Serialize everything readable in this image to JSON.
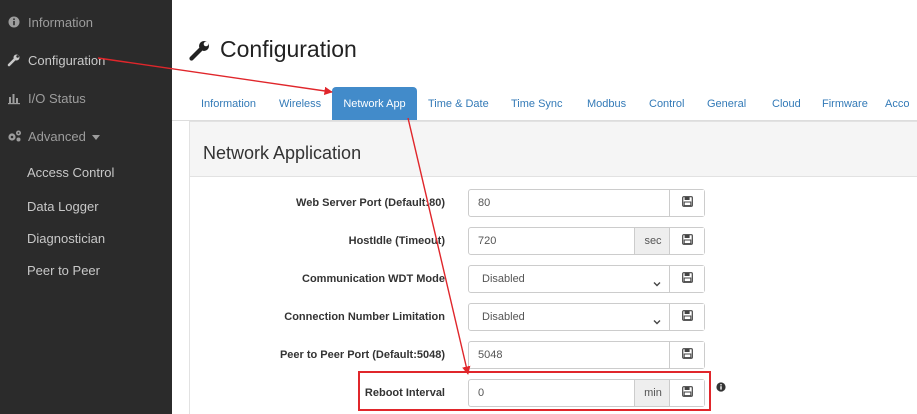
{
  "sidebar": {
    "items": [
      {
        "label": "Information"
      },
      {
        "label": "Configuration"
      },
      {
        "label": "I/O Status"
      },
      {
        "label": "Advanced"
      }
    ],
    "advanced_sub": [
      {
        "label": "Access Control"
      },
      {
        "label": "Data Logger"
      },
      {
        "label": "Diagnostician"
      },
      {
        "label": "Peer to Peer"
      }
    ]
  },
  "page": {
    "title": "Configuration"
  },
  "tabs": [
    {
      "label": "Information"
    },
    {
      "label": "Wireless"
    },
    {
      "label": "Network App"
    },
    {
      "label": "Time & Date"
    },
    {
      "label": "Time Sync"
    },
    {
      "label": "Modbus"
    },
    {
      "label": "Control"
    },
    {
      "label": "General"
    },
    {
      "label": "Cloud"
    },
    {
      "label": "Firmware"
    },
    {
      "label": "Acco"
    }
  ],
  "panel": {
    "title": "Network Application",
    "rows": [
      {
        "label": "Web Server Port (Default:80)",
        "value": "80"
      },
      {
        "label": "HostIdle (Timeout)",
        "value": "720",
        "unit": "sec"
      },
      {
        "label": "Communication WDT Mode",
        "value": "Disabled"
      },
      {
        "label": "Connection Number Limitation",
        "value": "Disabled"
      },
      {
        "label": "Peer to Peer Port (Default:5048)",
        "value": "5048"
      },
      {
        "label": "Reboot Interval",
        "value": "0",
        "unit": "min"
      }
    ]
  },
  "colors": {
    "sidebar_bg": "#2b2b2b",
    "tab_active": "#428bca",
    "link": "#337ab7",
    "annotation_red": "#e0262b"
  },
  "icons": {
    "information": "info-circle-icon",
    "configuration": "wrench-icon",
    "io_status": "bar-chart-icon",
    "advanced": "cogs-icon",
    "save": "floppy-disk-icon",
    "dropdown": "chevron-down-icon"
  }
}
